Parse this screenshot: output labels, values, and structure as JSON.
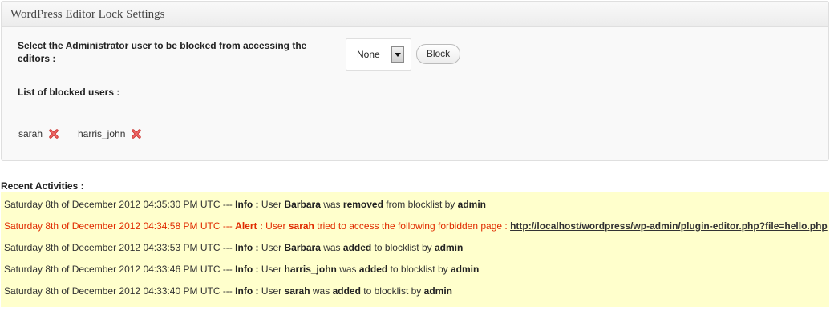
{
  "panel": {
    "title": "WordPress Editor Lock Settings",
    "select_label": "Select the Administrator user to be blocked from accessing the editors :",
    "select_value": "None",
    "block_button": "Block",
    "list_label": "List of blocked users :",
    "blocked_users": [
      {
        "name": "sarah",
        "remove_icon": "red-x-icon"
      },
      {
        "name": "harris_john",
        "remove_icon": "red-x-icon"
      }
    ]
  },
  "activities": {
    "title": "Recent Activities :",
    "rows": [
      {
        "type": "info",
        "timestamp": "Saturday 8th of December 2012 04:35:30 PM UTC ---",
        "level": "Info :",
        "pre": "User",
        "user": "Barbara",
        "mid": "was",
        "action": "removed",
        "post": "from blocklist by",
        "by": "admin"
      },
      {
        "type": "alert",
        "timestamp": "Saturday 8th of December 2012 04:34:58 PM UTC ---",
        "level": "Alert :",
        "pre": "User",
        "user": "sarah",
        "mid": "tried to access the following forbidden page :",
        "link": "http://localhost/wordpress/wp-admin/plugin-editor.php?file=hello.php"
      },
      {
        "type": "info",
        "timestamp": "Saturday 8th of December 2012 04:33:53 PM UTC ---",
        "level": "Info :",
        "pre": "User",
        "user": "Barbara",
        "mid": "was",
        "action": "added",
        "post": "to blocklist by",
        "by": "admin"
      },
      {
        "type": "info",
        "timestamp": "Saturday 8th of December 2012 04:33:46 PM UTC ---",
        "level": "Info :",
        "pre": "User",
        "user": "harris_john",
        "mid": "was",
        "action": "added",
        "post": "to blocklist by",
        "by": "admin"
      },
      {
        "type": "info",
        "timestamp": "Saturday 8th of December 2012 04:33:40 PM UTC ---",
        "level": "Info :",
        "pre": "User",
        "user": "sarah",
        "mid": "was",
        "action": "added",
        "post": "to blocklist by",
        "by": "admin"
      }
    ]
  },
  "colors": {
    "alert": "#e02b00",
    "log_background": "#ffffcc",
    "remove_icon": "#e03a3a"
  }
}
